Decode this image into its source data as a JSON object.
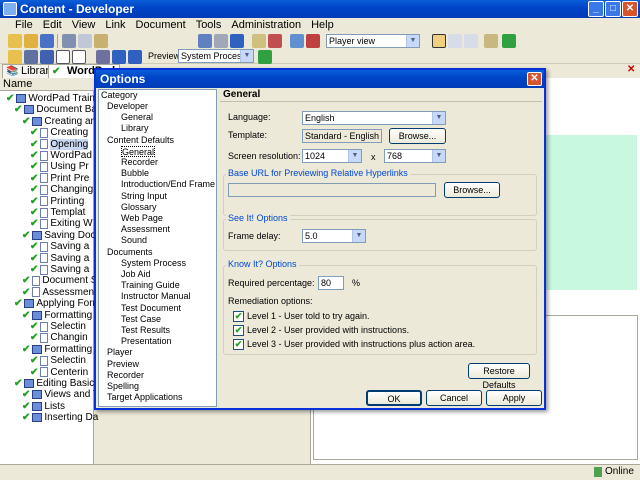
{
  "app": {
    "title": "Content - Developer"
  },
  "menu": [
    "File",
    "Edit",
    "View",
    "Link",
    "Document",
    "Tools",
    "Administration",
    "Help"
  ],
  "toolbar": {
    "player_view_value": "Player view",
    "preview_label": "Preview:",
    "preview_value": "System Process"
  },
  "tabs": {
    "library": "Library",
    "doc": "WordPad"
  },
  "left": {
    "name_header": "Name",
    "tree": [
      "WordPad Training",
      "Document Basics",
      "Creating and",
      "Creating",
      "Opening",
      "WordPad",
      "Using Pr",
      "Print Pre",
      "Changing",
      "Printing",
      "Templat",
      "Exiting W",
      "Saving Docu",
      "Saving a",
      "Saving a",
      "Saving a",
      "Document S",
      "Assessment",
      "Applying Forma",
      "Formatting",
      "Selectin",
      "Changin",
      "Formatting",
      "Selectin",
      "Centerin",
      "Editing Basics",
      "Views and T",
      "Lists",
      "Inserting Da"
    ]
  },
  "status": {
    "online": "Online"
  },
  "dialog": {
    "title": "Options",
    "category_header": "Category",
    "categories": [
      "Developer",
      "General",
      "Library",
      "Content Defaults",
      "General",
      "Recorder",
      "Bubble",
      "Introduction/End Frame",
      "String Input",
      "Glossary",
      "Web Page",
      "Assessment",
      "Sound",
      "Documents",
      "System Process",
      "Job Aid",
      "Training Guide",
      "Instructor Manual",
      "Test Document",
      "Test Case",
      "Test Results",
      "Presentation",
      "Player",
      "Preview",
      "Recorder",
      "Spelling",
      "Target Applications"
    ],
    "panel_title": "General",
    "language_label": "Language:",
    "language_value": "English",
    "template_label": "Template:",
    "template_value": "Standard - English",
    "browse_label": "Browse...",
    "resolution_label": "Screen resolution:",
    "res_w": "1024",
    "res_x": "x",
    "res_h": "768",
    "base_url_group": "Base URL for Previewing Relative Hyperlinks",
    "base_url_value": "",
    "see_it_group": "See It! Options",
    "frame_delay_label": "Frame delay:",
    "frame_delay_value": "5.0",
    "know_it_group": "Know It? Options",
    "required_pct_label": "Required percentage:",
    "required_pct_value": "80",
    "pct_symbol": "%",
    "remediation_label": "Remediation options:",
    "levels": [
      "Level 1 - User told to try again.",
      "Level 2 - User provided with instructions.",
      "Level 3 - User provided with instructions plus action area."
    ],
    "restore_label": "Restore Defaults",
    "ok_label": "OK",
    "cancel_label": "Cancel",
    "apply_label": "Apply"
  },
  "colors": {
    "title_blue": "#0045c8",
    "check_green": "#21a121",
    "group_label": "#0046d5"
  }
}
